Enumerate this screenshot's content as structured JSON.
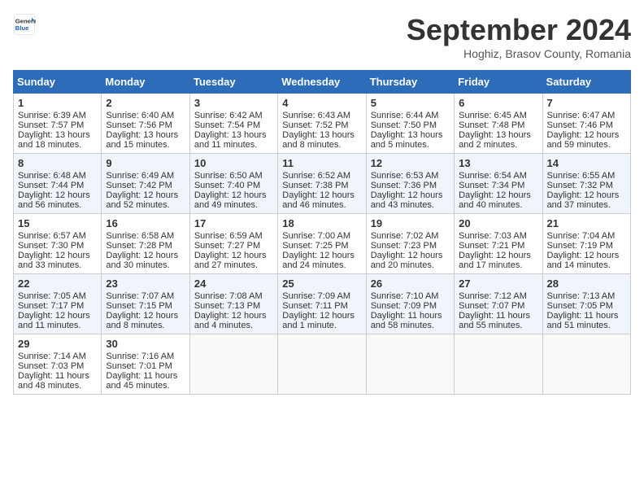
{
  "logo": {
    "line1": "General",
    "line2": "Blue"
  },
  "title": "September 2024",
  "location": "Hoghiz, Brasov County, Romania",
  "days_header": [
    "Sunday",
    "Monday",
    "Tuesday",
    "Wednesday",
    "Thursday",
    "Friday",
    "Saturday"
  ],
  "weeks": [
    [
      {
        "day": 1,
        "info": "Sunrise: 6:39 AM\nSunset: 7:57 PM\nDaylight: 13 hours and 18 minutes."
      },
      {
        "day": 2,
        "info": "Sunrise: 6:40 AM\nSunset: 7:56 PM\nDaylight: 13 hours and 15 minutes."
      },
      {
        "day": 3,
        "info": "Sunrise: 6:42 AM\nSunset: 7:54 PM\nDaylight: 13 hours and 11 minutes."
      },
      {
        "day": 4,
        "info": "Sunrise: 6:43 AM\nSunset: 7:52 PM\nDaylight: 13 hours and 8 minutes."
      },
      {
        "day": 5,
        "info": "Sunrise: 6:44 AM\nSunset: 7:50 PM\nDaylight: 13 hours and 5 minutes."
      },
      {
        "day": 6,
        "info": "Sunrise: 6:45 AM\nSunset: 7:48 PM\nDaylight: 13 hours and 2 minutes."
      },
      {
        "day": 7,
        "info": "Sunrise: 6:47 AM\nSunset: 7:46 PM\nDaylight: 12 hours and 59 minutes."
      }
    ],
    [
      {
        "day": 8,
        "info": "Sunrise: 6:48 AM\nSunset: 7:44 PM\nDaylight: 12 hours and 56 minutes."
      },
      {
        "day": 9,
        "info": "Sunrise: 6:49 AM\nSunset: 7:42 PM\nDaylight: 12 hours and 52 minutes."
      },
      {
        "day": 10,
        "info": "Sunrise: 6:50 AM\nSunset: 7:40 PM\nDaylight: 12 hours and 49 minutes."
      },
      {
        "day": 11,
        "info": "Sunrise: 6:52 AM\nSunset: 7:38 PM\nDaylight: 12 hours and 46 minutes."
      },
      {
        "day": 12,
        "info": "Sunrise: 6:53 AM\nSunset: 7:36 PM\nDaylight: 12 hours and 43 minutes."
      },
      {
        "day": 13,
        "info": "Sunrise: 6:54 AM\nSunset: 7:34 PM\nDaylight: 12 hours and 40 minutes."
      },
      {
        "day": 14,
        "info": "Sunrise: 6:55 AM\nSunset: 7:32 PM\nDaylight: 12 hours and 37 minutes."
      }
    ],
    [
      {
        "day": 15,
        "info": "Sunrise: 6:57 AM\nSunset: 7:30 PM\nDaylight: 12 hours and 33 minutes."
      },
      {
        "day": 16,
        "info": "Sunrise: 6:58 AM\nSunset: 7:28 PM\nDaylight: 12 hours and 30 minutes."
      },
      {
        "day": 17,
        "info": "Sunrise: 6:59 AM\nSunset: 7:27 PM\nDaylight: 12 hours and 27 minutes."
      },
      {
        "day": 18,
        "info": "Sunrise: 7:00 AM\nSunset: 7:25 PM\nDaylight: 12 hours and 24 minutes."
      },
      {
        "day": 19,
        "info": "Sunrise: 7:02 AM\nSunset: 7:23 PM\nDaylight: 12 hours and 20 minutes."
      },
      {
        "day": 20,
        "info": "Sunrise: 7:03 AM\nSunset: 7:21 PM\nDaylight: 12 hours and 17 minutes."
      },
      {
        "day": 21,
        "info": "Sunrise: 7:04 AM\nSunset: 7:19 PM\nDaylight: 12 hours and 14 minutes."
      }
    ],
    [
      {
        "day": 22,
        "info": "Sunrise: 7:05 AM\nSunset: 7:17 PM\nDaylight: 12 hours and 11 minutes."
      },
      {
        "day": 23,
        "info": "Sunrise: 7:07 AM\nSunset: 7:15 PM\nDaylight: 12 hours and 8 minutes."
      },
      {
        "day": 24,
        "info": "Sunrise: 7:08 AM\nSunset: 7:13 PM\nDaylight: 12 hours and 4 minutes."
      },
      {
        "day": 25,
        "info": "Sunrise: 7:09 AM\nSunset: 7:11 PM\nDaylight: 12 hours and 1 minute."
      },
      {
        "day": 26,
        "info": "Sunrise: 7:10 AM\nSunset: 7:09 PM\nDaylight: 11 hours and 58 minutes."
      },
      {
        "day": 27,
        "info": "Sunrise: 7:12 AM\nSunset: 7:07 PM\nDaylight: 11 hours and 55 minutes."
      },
      {
        "day": 28,
        "info": "Sunrise: 7:13 AM\nSunset: 7:05 PM\nDaylight: 11 hours and 51 minutes."
      }
    ],
    [
      {
        "day": 29,
        "info": "Sunrise: 7:14 AM\nSunset: 7:03 PM\nDaylight: 11 hours and 48 minutes."
      },
      {
        "day": 30,
        "info": "Sunrise: 7:16 AM\nSunset: 7:01 PM\nDaylight: 11 hours and 45 minutes."
      },
      null,
      null,
      null,
      null,
      null
    ]
  ]
}
